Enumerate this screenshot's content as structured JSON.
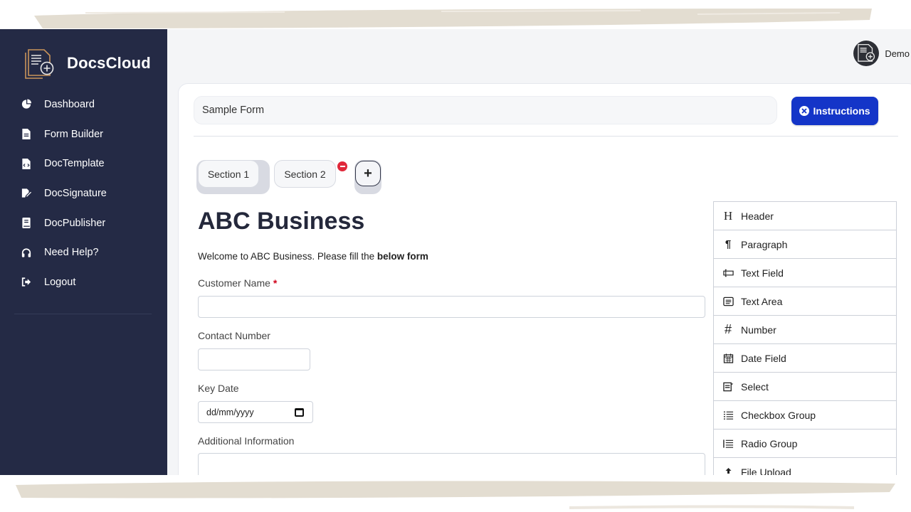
{
  "app": {
    "name": "DocsCloud"
  },
  "user": {
    "name": "Demo"
  },
  "sidebar": {
    "items": [
      {
        "label": "Dashboard",
        "icon": "pie-chart-icon"
      },
      {
        "label": "Form Builder",
        "icon": "file-icon"
      },
      {
        "label": "DocTemplate",
        "icon": "file-code-icon"
      },
      {
        "label": "DocSignature",
        "icon": "signature-icon"
      },
      {
        "label": "DocPublisher",
        "icon": "book-icon"
      },
      {
        "label": "Need Help?",
        "icon": "headphones-icon"
      },
      {
        "label": "Logout",
        "icon": "logout-icon"
      }
    ]
  },
  "form": {
    "title_value": "Sample Form",
    "instructions_label": "Instructions",
    "sections": [
      "Section 1",
      "Section 2"
    ],
    "add_section_label": "+",
    "heading": "ABC Business",
    "welcome_text": "Welcome to ABC Business. Please fill the ",
    "welcome_bold": "below form",
    "fields": {
      "customer_name": "Customer Name",
      "required_mark": "*",
      "contact_number": "Contact Number",
      "key_date": "Key Date",
      "key_date_placeholder": "dd/mm/yyyy",
      "additional_info": "Additional Information"
    }
  },
  "palette": {
    "items": [
      {
        "label": "Header",
        "icon": "header-icon"
      },
      {
        "label": "Paragraph",
        "icon": "paragraph-icon"
      },
      {
        "label": "Text Field",
        "icon": "text-field-icon"
      },
      {
        "label": "Text Area",
        "icon": "text-area-icon"
      },
      {
        "label": "Number",
        "icon": "hash-icon"
      },
      {
        "label": "Date Field",
        "icon": "calendar-icon"
      },
      {
        "label": "Select",
        "icon": "select-icon"
      },
      {
        "label": "Checkbox Group",
        "icon": "checkbox-list-icon"
      },
      {
        "label": "Radio Group",
        "icon": "radio-list-icon"
      },
      {
        "label": "File Upload",
        "icon": "upload-icon"
      }
    ]
  },
  "colors": {
    "sidebar_bg": "#242a45",
    "accent": "#1435c8",
    "danger": "#e0283a"
  }
}
